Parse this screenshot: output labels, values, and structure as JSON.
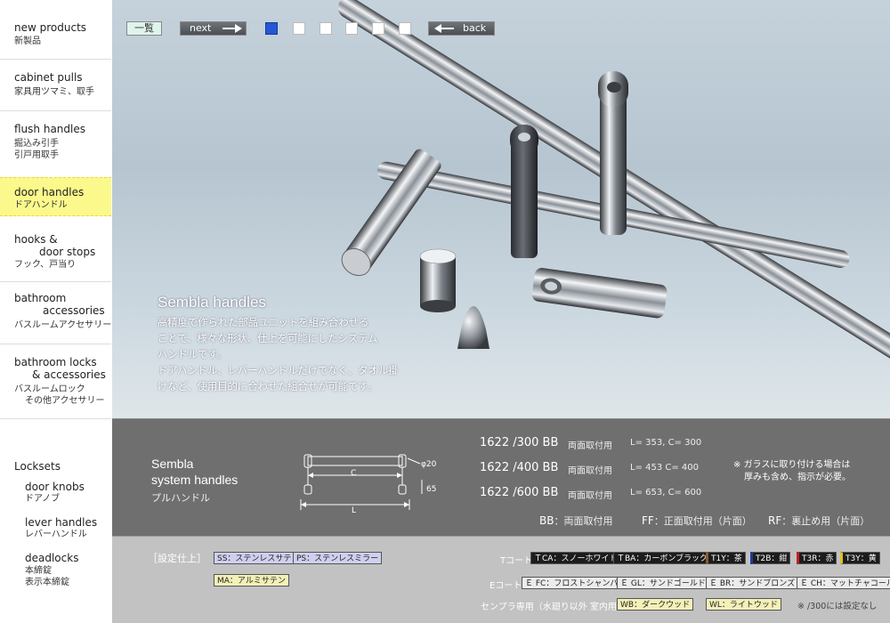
{
  "nav": {
    "items": [
      {
        "en": "new products",
        "jp": "新製品"
      },
      {
        "en": "cabinet pulls",
        "jp": "家具用ツマミ、取手"
      },
      {
        "en": "flush handles",
        "jp": "掘込み引手",
        "jp2": "引戸用取手"
      },
      {
        "en": "door handles",
        "jp": "ドアハンドル"
      },
      {
        "en": "hooks &",
        "en2": "door stops",
        "jp": "フック、戸当り"
      },
      {
        "en": "bathroom",
        "en2": "accessories",
        "jp": "バスルームアクセサリー"
      },
      {
        "en": "bathroom locks",
        "en2": "& accessories",
        "jp": "バスルームロック",
        "jp2": "その他アクセサリー"
      }
    ],
    "locksets": {
      "title": "Locksets",
      "items": [
        {
          "en": "door knobs",
          "jp": "ドアノブ"
        },
        {
          "en": "lever handles",
          "jp": "レバーハンドル"
        },
        {
          "en": "deadlocks",
          "jp": "本締錠",
          "jp2": "表示本締錠"
        }
      ]
    }
  },
  "toolbar": {
    "list": "一覧",
    "next": "next",
    "back": "back",
    "pages": 6,
    "active_page": 1
  },
  "hero": {
    "title": "Sembla handles",
    "desc": [
      "高精度で作られた部品ユニットを組み合わせる",
      "ことで、様々な形状、仕上を可能にしたシステム",
      "ハンドルです。",
      "ドアハンドル、レバーハンドルだけでなく、タオル掛",
      "けなど、使用目的に合わせた組合せが可能です。"
    ]
  },
  "spec": {
    "name1": "Sembla",
    "name2": "system handles",
    "jp": "プルハンドル",
    "diagram": {
      "c": "C",
      "l": "L",
      "d": "φ20",
      "h": "65"
    },
    "rows": [
      {
        "code": "1622 /300 BB",
        "mount": "両面取付用",
        "dims": "L= 353,   C= 300"
      },
      {
        "code": "1622 /400 BB",
        "mount": "両面取付用",
        "dims": "L= 453   C= 400"
      },
      {
        "code": "1622 /600 BB",
        "mount": "両面取付用",
        "dims": "L= 653,   C= 600"
      }
    ],
    "note1": "※ ガラスに取り付ける場合は",
    "note2": "厚みも含め、指示が必要。",
    "legend": [
      {
        "code": "BB",
        "text": "：両面取付用"
      },
      {
        "code": "FF",
        "text": "：正面取付用（片面）"
      },
      {
        "code": "RF",
        "text": "：裏止め用（片面）"
      }
    ]
  },
  "finish": {
    "label": "［設定仕上］",
    "ss": "SS：ステンレスサテン",
    "ps": "PS：ステンレスミラー",
    "ma": "MA：アルミサテン",
    "t_label": "Tコート",
    "e_label": "Eコート",
    "w_label": "センプラ専用（水廻り以外 室内用）",
    "tca": "ＴCA：スノーホワイト",
    "tba": "ＴBA：カーボンブラック",
    "t1y": "T1Y：茶",
    "t2b": "T2B：紺",
    "t3r": "T3R：赤",
    "t3y": "T3Y：黄",
    "efc": "Ｅ FC：フロストシャンパン",
    "egl": "Ｅ GL：サンドゴールド",
    "ebr": "Ｅ BR：サンドブロンズ",
    "ech": "Ｅ CH：マットチャコール",
    "wb": "WB：ダークウッド",
    "wl": "WL：ライトウッド",
    "note": "※ /300には設定なし"
  }
}
